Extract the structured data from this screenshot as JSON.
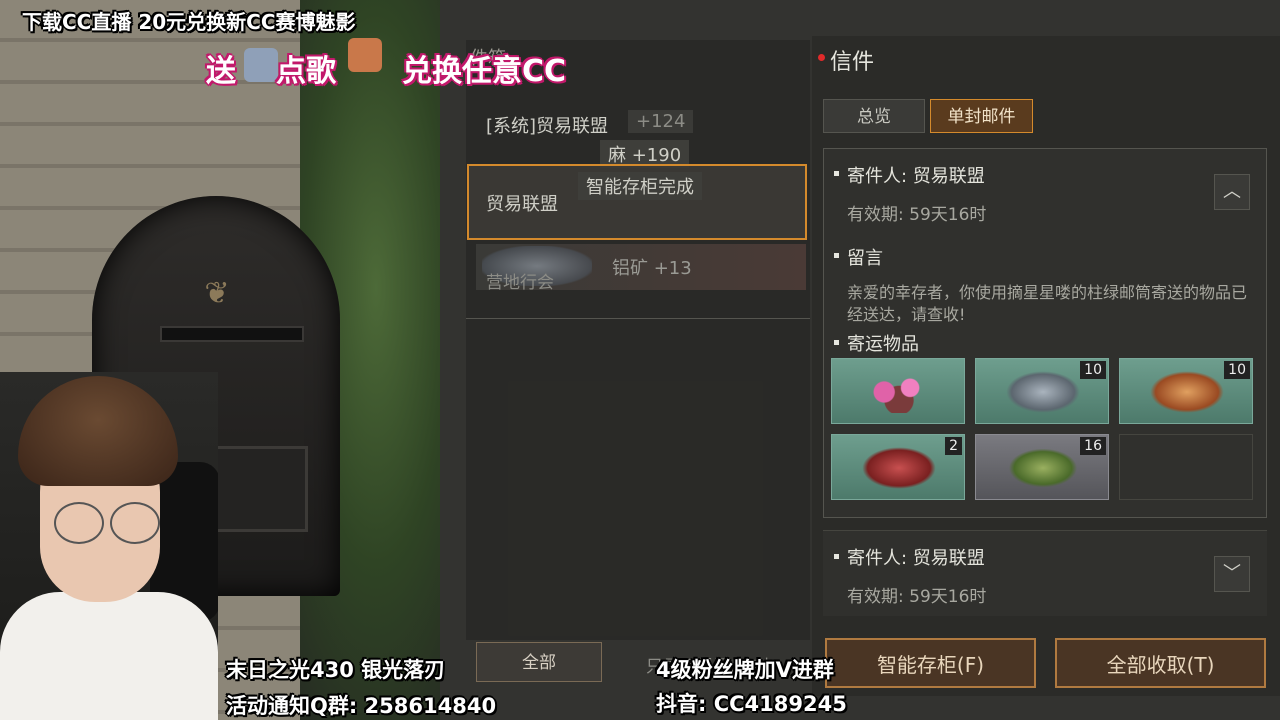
{
  "stream_overlay": {
    "top_banner": "下载CC直播  20元兑换新CC赛博魅影",
    "sub_banner_1": "送",
    "sub_banner_2": "点歌",
    "sub_banner_3": "兑换任意CC",
    "bottom_left_1": "末日之光430  银光落刃",
    "bottom_left_2": "活动通知Q群: 258614840",
    "bottom_mid_1": "4级粉丝牌加V进群",
    "bottom_mid_2": "抖音: CC4189245"
  },
  "mail_list": {
    "header": "件箱",
    "rows": [
      {
        "sender": "[系统]贸易联盟",
        "reward": "+124"
      },
      {
        "reward": "麻 +190"
      },
      {
        "sender": "贸易联盟",
        "tag": "智能存柜完成",
        "selected": true
      },
      {
        "sender": "营地行会",
        "reward": "铝矿 +13"
      }
    ],
    "all_button": "全部",
    "show_recent": "只显示最近50封"
  },
  "mail_panel": {
    "title": "信件",
    "tabs": [
      {
        "label": "总览",
        "active": false
      },
      {
        "label": "单封邮件",
        "active": true
      }
    ],
    "mail_1": {
      "sender_label": "寄件人: 贸易联盟",
      "expiry": "有效期: 59天16时",
      "message_label": "留言",
      "message": "亲爱的幸存者，你使用摘星星喽的柱绿邮筒寄送的物品已经送达，请查收!",
      "items_label": "寄运物品",
      "items": [
        {
          "icon": "flower-branch-icon",
          "qty": ""
        },
        {
          "icon": "ore-icon",
          "qty": "10"
        },
        {
          "icon": "bread-icon",
          "qty": "10"
        },
        {
          "icon": "meat-icon",
          "qty": "2"
        },
        {
          "icon": "herb-icon",
          "qty": "16"
        },
        {
          "icon": "empty-slot",
          "qty": ""
        }
      ]
    },
    "mail_2": {
      "sender_label": "寄件人: 贸易联盟",
      "expiry": "有效期: 59天16时"
    },
    "buttons": {
      "smart_store": "智能存柜(F)",
      "collect_all": "全部收取(T)"
    }
  },
  "colors": {
    "accent": "#d48a2c",
    "alert": "#e02a2a",
    "item_bg": "#6e9e8e"
  }
}
